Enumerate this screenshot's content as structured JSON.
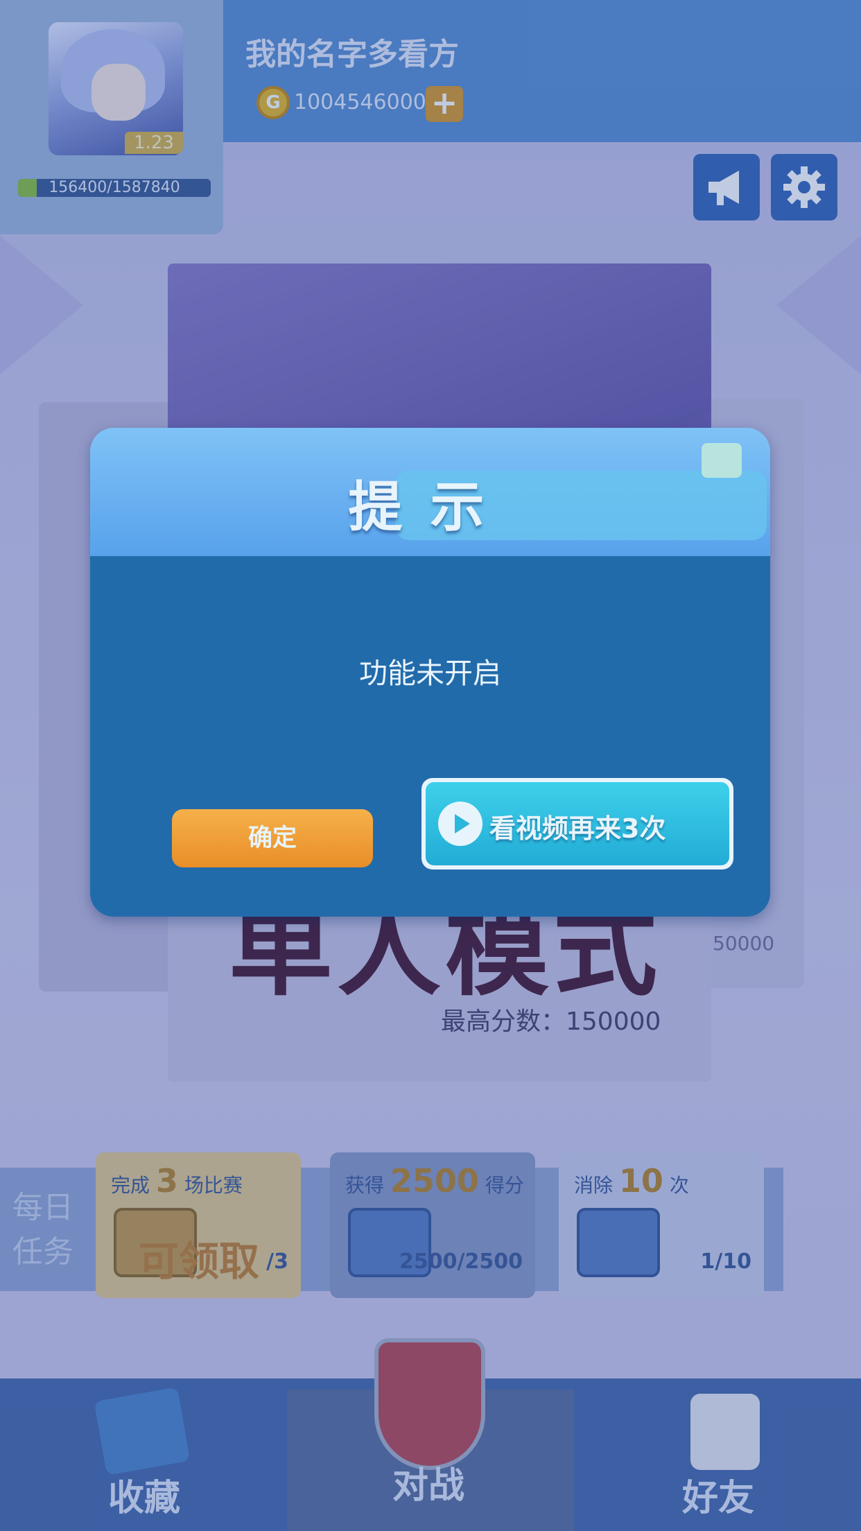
{
  "player": {
    "name": "我的名字多看方",
    "level": "1.23",
    "exp_text": "156400/1587840",
    "exp_fraction": 0.0985,
    "coins": "1004546000"
  },
  "header": {
    "coin_symbol": "G",
    "add_coins_label": "+",
    "announcement_icon": "megaphone-icon",
    "settings_icon": "gear-icon"
  },
  "mode_card": {
    "title": "单人模式",
    "best_score": "最高分数：150000",
    "right_card_score": "50000"
  },
  "daily_tasks": {
    "label": "每日任务",
    "tasks": [
      {
        "prefix": "完成",
        "num": "3",
        "suffix": "场比赛",
        "progress": "/3",
        "status": "可领取"
      },
      {
        "prefix": "获得",
        "num": "2500",
        "suffix": "得分",
        "progress": "2500/2500"
      },
      {
        "prefix": "消除",
        "num": "10",
        "suffix": "次",
        "progress": "1/10"
      }
    ]
  },
  "nav": {
    "collect": "收藏",
    "battle": "对战",
    "friends": "好友"
  },
  "dialog": {
    "title": "提示",
    "message": "功能未开启",
    "confirm_label": "确定",
    "watch_video_label": "看视频再来3次"
  },
  "colors": {
    "dialog_text": "#e8f4fb",
    "dialog_body": "#226bab",
    "confirm": "#f0a23a",
    "watch_video": "#2bb7dc"
  }
}
